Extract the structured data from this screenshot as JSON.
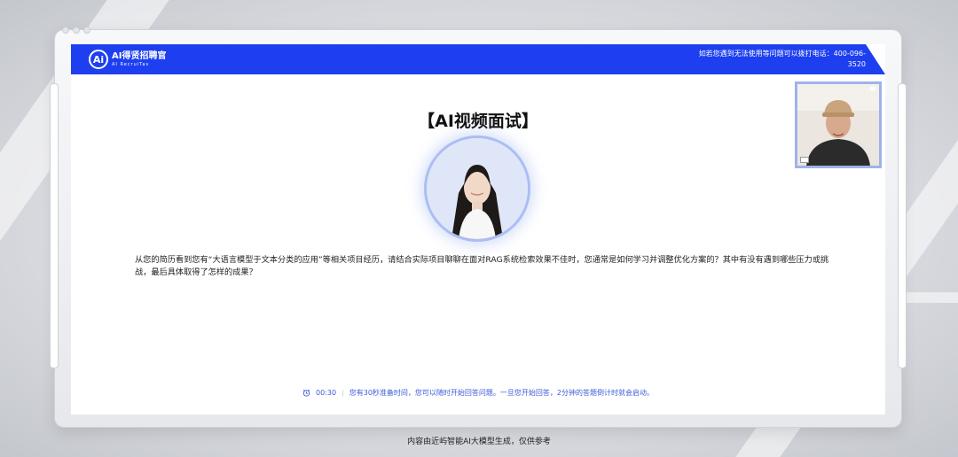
{
  "header": {
    "logo_mark": "Ai",
    "logo_title": "AI得贤招聘官",
    "logo_subtitle": "AI RecruiTas",
    "hotline": "如若您遇到无法使用等问题可以拨打电话：400-096-3520"
  },
  "main": {
    "title": "【AI视频面试】",
    "question": "从您的简历看到您有“大语言模型于文本分类的应用”等相关项目经历，请结合实际项目聊聊在面对RAG系统检索效果不佳时，您通常是如何学习并调整优化方案的？其中有没有遇到哪些压力或挑战，最后具体取得了怎样的成果？",
    "interviewer_avatar_icon": "interviewer-avatar",
    "candidate_camera_icon": "candidate-camera-feed"
  },
  "status": {
    "timer_icon": "alarm-clock-icon",
    "timer": "00:30",
    "hint": "您有30秒准备时间，您可以随时开始回答问题。一旦您开始回答，2分钟的答题倒计时就会启动。"
  },
  "footer": {
    "disclaimer": "内容由近屿智能AI大模型生成，仅供参考"
  },
  "colors": {
    "header_blue": "#1d3ff0",
    "ring_blue": "#aabef3",
    "hint_blue": "#3a5bd9"
  }
}
